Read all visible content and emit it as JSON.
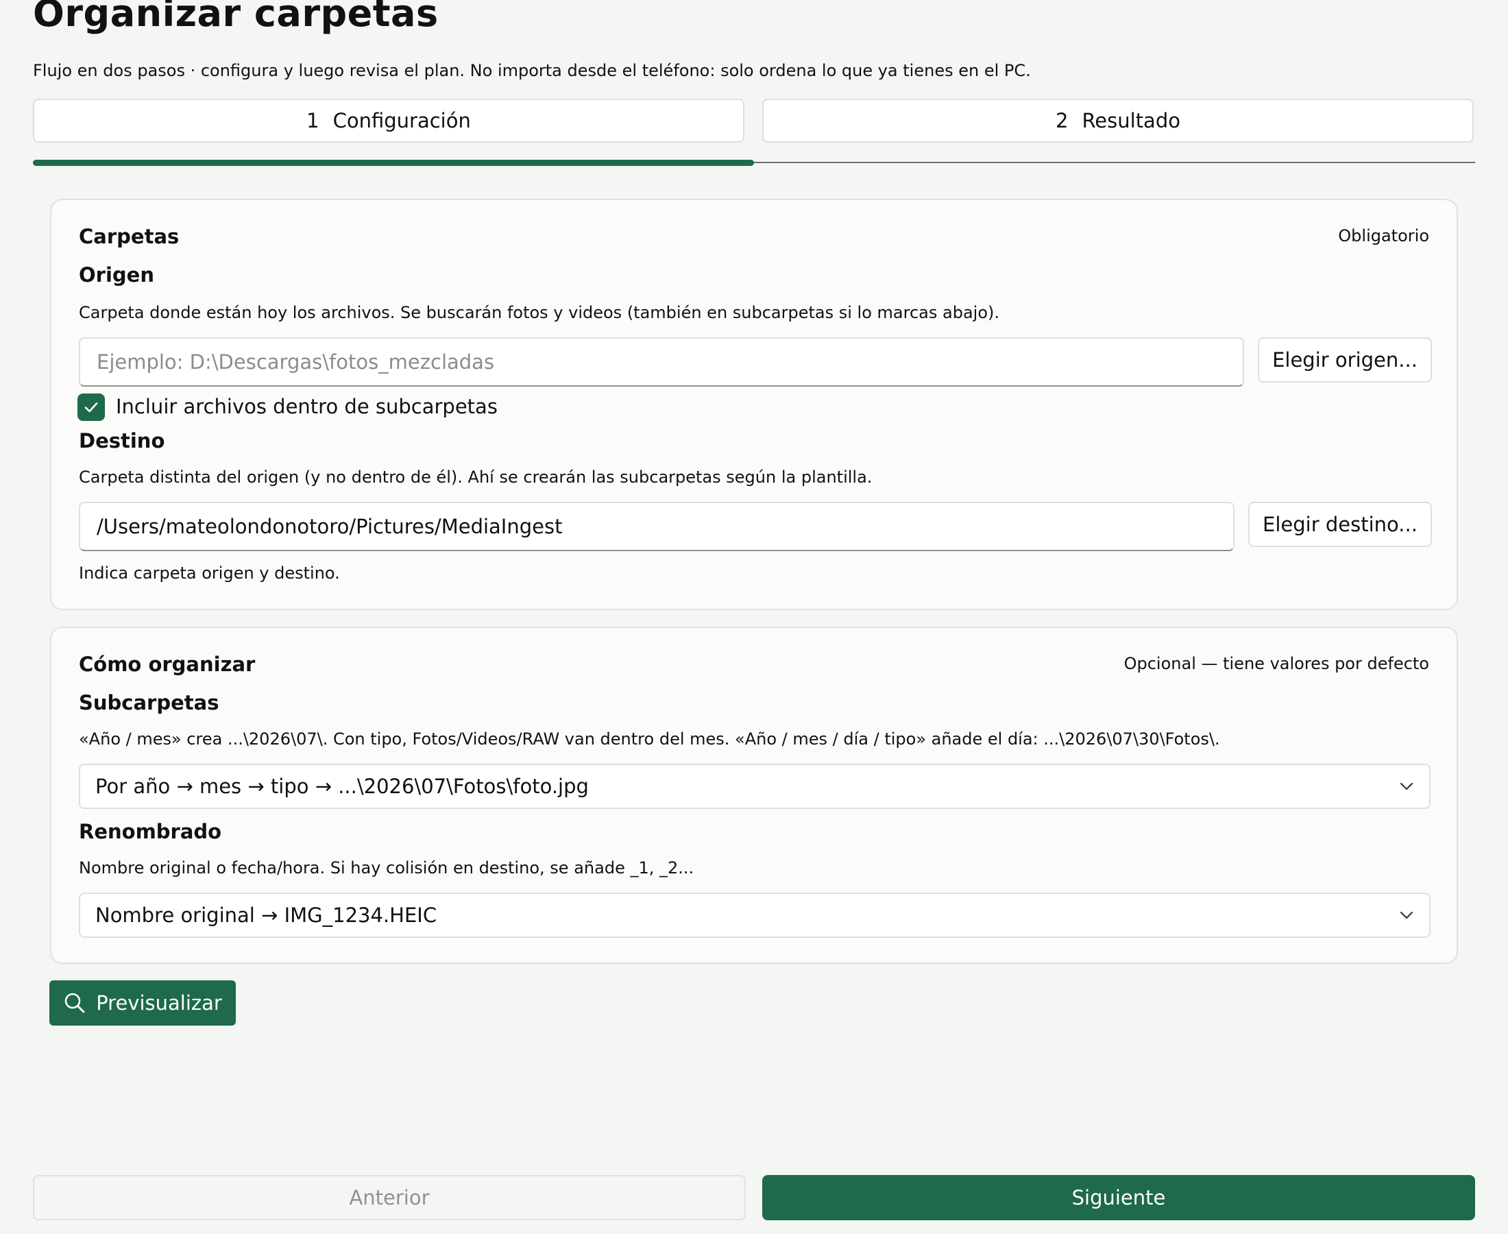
{
  "page": {
    "title": "Organizar carpetas",
    "subtitle": "Flujo en dos pasos · configura y luego revisa el plan. No importa desde el teléfono: solo ordena lo que ya tienes en el PC."
  },
  "steps": [
    {
      "number": "1",
      "label": "Configuración",
      "active": true
    },
    {
      "number": "2",
      "label": "Resultado",
      "active": false
    }
  ],
  "progress": {
    "current_step": 1,
    "total_steps": 2,
    "fraction": 0.5
  },
  "folders_card": {
    "title": "Carpetas",
    "meta": "Obligatorio",
    "origin": {
      "label": "Origen",
      "help": "Carpeta donde están hoy los archivos. Se buscarán fotos y videos (también en subcarpetas si lo marcas abajo).",
      "value": "",
      "placeholder": "Ejemplo: D:\\Descargas\\fotos_mezcladas",
      "button": "Elegir origen..."
    },
    "include_subfolders": {
      "label": "Incluir archivos dentro de subcarpetas",
      "checked": true
    },
    "destination": {
      "label": "Destino",
      "help": "Carpeta distinta del origen (y no dentro de él). Ahí se crearán las subcarpetas según la plantilla.",
      "value": "/Users/mateolondonotoro/Pictures/MediaIngest",
      "placeholder": "",
      "button": "Elegir destino..."
    },
    "validation_message": "Indica carpeta origen y destino."
  },
  "organize_card": {
    "title": "Cómo organizar",
    "meta": "Opcional — tiene valores por defecto",
    "subfolders": {
      "label": "Subcarpetas",
      "help": "«Año / mes» crea ...\\2026\\07\\. Con tipo, Fotos/Videos/RAW van dentro del mes. «Año / mes / día / tipo» añade el día: ...\\2026\\07\\30\\Fotos\\.",
      "selected": "Por año → mes → tipo → ...\\2026\\07\\Fotos\\foto.jpg"
    },
    "renaming": {
      "label": "Renombrado",
      "help": "Nombre original o fecha/hora. Si hay colisión en destino, se añade _1, _2...",
      "selected": "Nombre original → IMG_1234.HEIC"
    }
  },
  "actions": {
    "preview": "Previsualizar",
    "previous": "Anterior",
    "next": "Siguiente"
  },
  "colors": {
    "accent": "#1e6a4a",
    "background": "#f4f6f3",
    "card": "#fbfcfa",
    "border": "#dfe2de",
    "disabled_text": "#8f928e"
  },
  "icons": {
    "preview": "search-icon",
    "checkbox": "check-icon",
    "select": "chevron-down-icon"
  }
}
